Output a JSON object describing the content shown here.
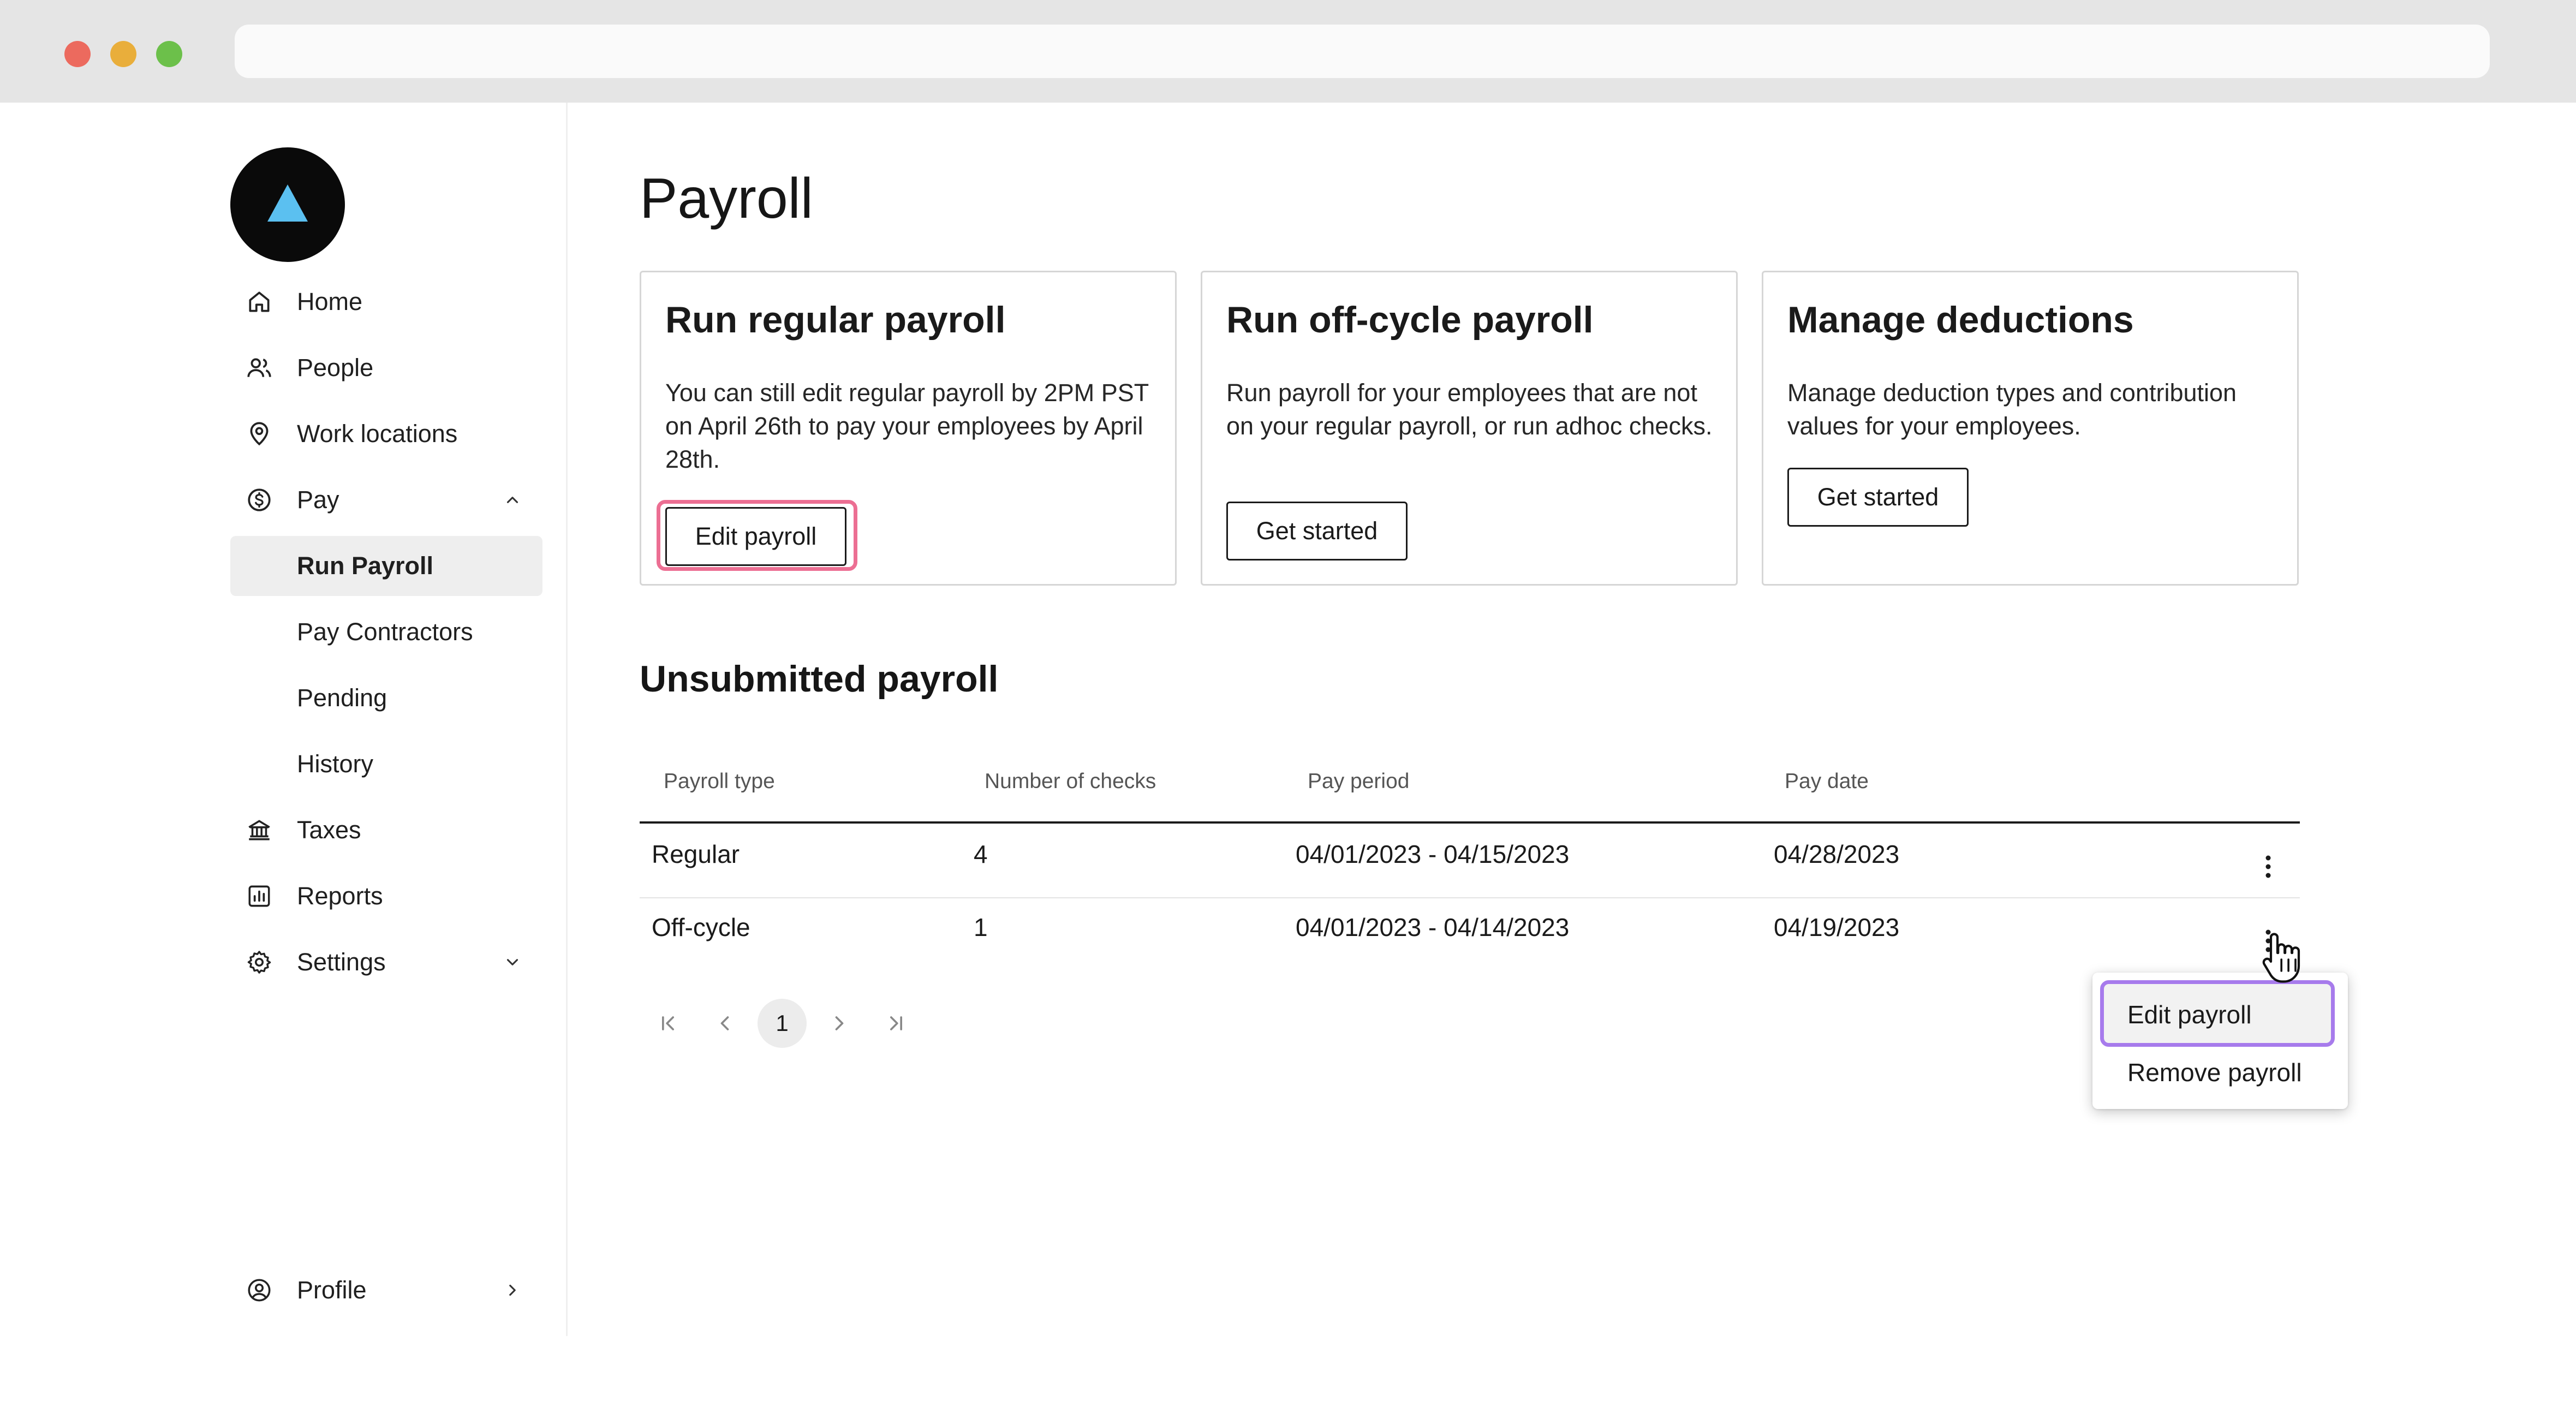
{
  "app": {
    "page_title": "Payroll"
  },
  "sidebar": {
    "items": [
      {
        "label": "Home",
        "icon": "home-icon"
      },
      {
        "label": "People",
        "icon": "people-icon"
      },
      {
        "label": "Work locations",
        "icon": "location-pin-icon"
      },
      {
        "label": "Pay",
        "icon": "dollar-circle-icon",
        "expanded": true
      },
      {
        "label": "Run Payroll",
        "active": true
      },
      {
        "label": "Pay Contractors"
      },
      {
        "label": "Pending"
      },
      {
        "label": "History"
      },
      {
        "label": "Taxes",
        "icon": "bank-icon"
      },
      {
        "label": "Reports",
        "icon": "bar-chart-icon"
      },
      {
        "label": "Settings",
        "icon": "gear-icon",
        "expanded": false
      },
      {
        "label": "Profile",
        "icon": "user-circle-icon"
      }
    ]
  },
  "cards": [
    {
      "title": "Run regular payroll",
      "description": "You can still edit regular payroll by 2PM PST on April 26th to pay your employees by April 28th.",
      "button": "Edit payroll"
    },
    {
      "title": "Run off-cycle payroll",
      "description": "Run payroll for your employees that are not on your regular payroll, or run adhoc checks.",
      "button": "Get started"
    },
    {
      "title": "Manage deductions",
      "description": "Manage deduction types and contribution values for your employees.",
      "button": "Get started"
    }
  ],
  "unsubmitted": {
    "title": "Unsubmitted payroll",
    "columns": [
      "Payroll type",
      "Number of checks",
      "Pay period",
      "Pay date"
    ],
    "rows": [
      {
        "type": "Regular",
        "checks": "4",
        "period": "04/01/2023 - 04/15/2023",
        "date": "04/28/2023"
      },
      {
        "type": "Off-cycle",
        "checks": "1",
        "period": "04/01/2023 - 04/14/2023",
        "date": "04/19/2023"
      }
    ],
    "pagination": {
      "current_page": "1"
    }
  },
  "row_menu": {
    "items": [
      "Edit payroll",
      "Remove payroll"
    ],
    "highlighted": "Edit payroll"
  },
  "colors": {
    "accent_logo": "#5bc0f0",
    "highlight_pink": "#ec6f93",
    "highlight_purple": "#a77bec"
  }
}
